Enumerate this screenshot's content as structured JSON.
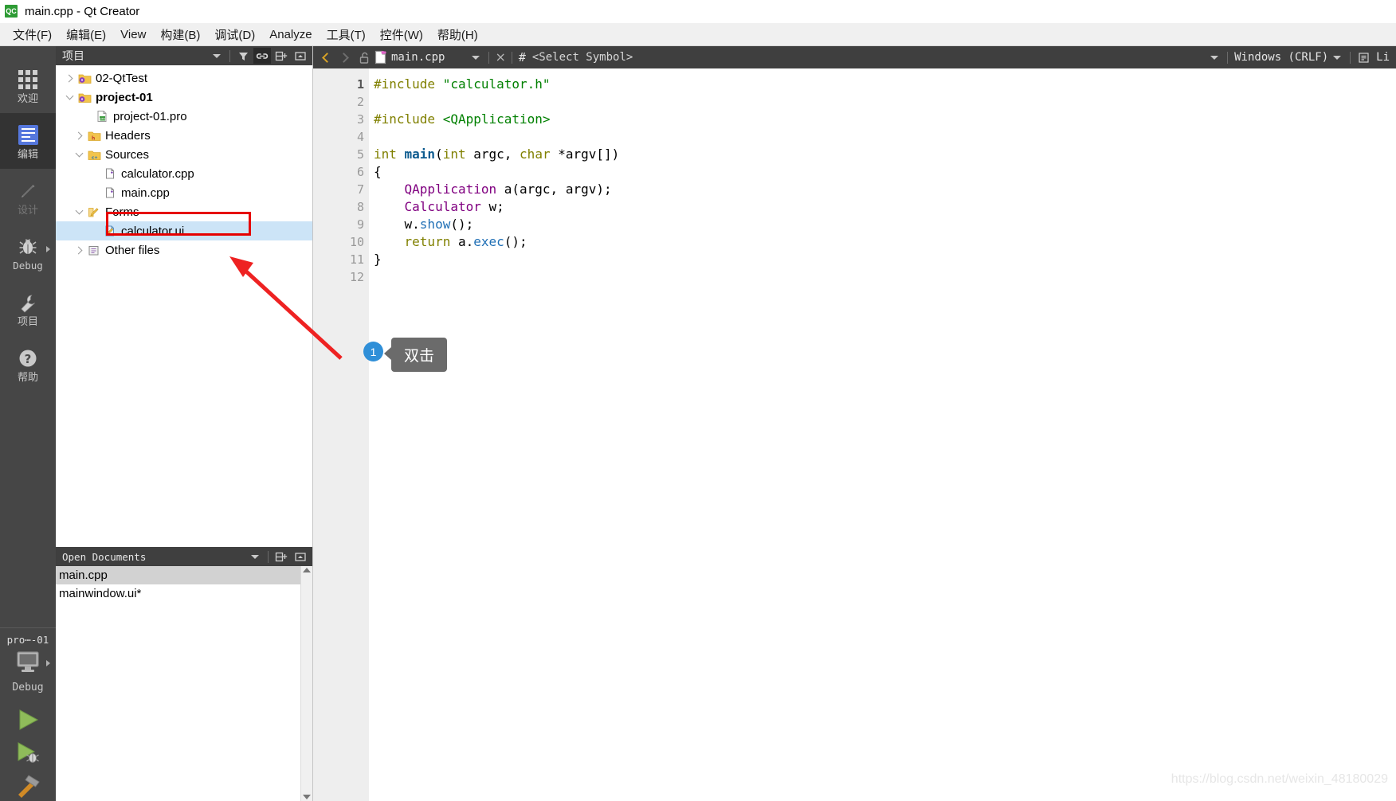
{
  "window": {
    "title": "main.cpp - Qt Creator",
    "logo_text": "QC",
    "logo_icon": "qt-creator-logo-icon"
  },
  "menubar": {
    "items": [
      {
        "label": "文件(F)",
        "name": "menu-file"
      },
      {
        "label": "编辑(E)",
        "name": "menu-edit"
      },
      {
        "label": "View",
        "name": "menu-view"
      },
      {
        "label": "构建(B)",
        "name": "menu-build"
      },
      {
        "label": "调试(D)",
        "name": "menu-debug"
      },
      {
        "label": "Analyze",
        "name": "menu-analyze"
      },
      {
        "label": "工具(T)",
        "name": "menu-tools"
      },
      {
        "label": "控件(W)",
        "name": "menu-widgets"
      },
      {
        "label": "帮助(H)",
        "name": "menu-help"
      }
    ]
  },
  "modebar": {
    "modes": [
      {
        "label": "欢迎",
        "icon": "grid-icon",
        "state": "normal"
      },
      {
        "label": "编辑",
        "icon": "edit-lines-icon",
        "state": "active"
      },
      {
        "label": "设计",
        "icon": "pencil-icon",
        "state": "disabled"
      },
      {
        "label": "Debug",
        "icon": "bug-icon",
        "state": "normal"
      },
      {
        "label": "项目",
        "icon": "wrench-icon",
        "state": "normal"
      },
      {
        "label": "帮助",
        "icon": "question-circle-icon",
        "state": "normal"
      }
    ],
    "kit": {
      "project_name": "pro⋯-01",
      "build_config": "Debug",
      "icon": "desktop-monitor-icon"
    },
    "run_buttons": [
      {
        "name": "run-button",
        "icon": "green-play-icon"
      },
      {
        "name": "debug-button",
        "icon": "play-with-bug-icon"
      },
      {
        "name": "build-button",
        "icon": "hammer-icon"
      }
    ]
  },
  "project_panel": {
    "title": "项目",
    "toolbar": [
      {
        "name": "filter-icon",
        "icon": "filter-icon",
        "active": false
      },
      {
        "name": "sync-with-editor-icon",
        "icon": "link-chain-icon",
        "active": true
      },
      {
        "name": "split-icon",
        "icon": "split-pane-icon",
        "active": false
      },
      {
        "name": "close-panel-icon",
        "icon": "minimize-panel-icon",
        "active": false
      }
    ],
    "tree": [
      {
        "label": "02-QtTest",
        "depth": 0,
        "twist": "collapsed",
        "icon": "project-folder-icon",
        "bold": false,
        "selected": false
      },
      {
        "label": "project-01",
        "depth": 0,
        "twist": "expanded",
        "icon": "project-folder-icon",
        "bold": true,
        "selected": false
      },
      {
        "label": "project-01.pro",
        "depth": 1,
        "twist": "none",
        "icon": "pro-file-icon",
        "bold": false,
        "selected": false
      },
      {
        "label": "Headers",
        "depth": 1,
        "twist": "collapsed",
        "icon": "headers-folder-icon",
        "bold": false,
        "selected": false
      },
      {
        "label": "Sources",
        "depth": 1,
        "twist": "expanded",
        "icon": "sources-folder-icon",
        "bold": false,
        "selected": false
      },
      {
        "label": "calculator.cpp",
        "depth": 2,
        "twist": "none",
        "icon": "cpp-file-icon",
        "bold": false,
        "selected": false
      },
      {
        "label": "main.cpp",
        "depth": 2,
        "twist": "none",
        "icon": "cpp-file-icon",
        "bold": false,
        "selected": false
      },
      {
        "label": "Forms",
        "depth": 1,
        "twist": "expanded",
        "icon": "forms-folder-icon",
        "bold": false,
        "selected": false
      },
      {
        "label": "calculator.ui",
        "depth": 2,
        "twist": "none",
        "icon": "ui-file-icon",
        "bold": false,
        "selected": true
      },
      {
        "label": "Other files",
        "depth": 1,
        "twist": "collapsed",
        "icon": "other-files-icon",
        "bold": false,
        "selected": false
      }
    ]
  },
  "open_documents": {
    "title": "Open Documents",
    "toolbar": [
      {
        "name": "split-icon",
        "icon": "split-pane-icon"
      },
      {
        "name": "close-panel-icon",
        "icon": "minimize-panel-icon"
      }
    ],
    "items": [
      {
        "label": "main.cpp",
        "selected": true
      },
      {
        "label": "mainwindow.ui*",
        "selected": false
      }
    ]
  },
  "editor_toolbar": {
    "back_icon": "chevron-left-icon",
    "forward_icon": "chevron-right-icon",
    "lock_icon": "unlocked-padlock-icon",
    "file_icon": "cpp-document-icon",
    "file_name": "main.cpp",
    "close_label": "×",
    "hash_label": "#",
    "symbol_placeholder": "<Select Symbol>",
    "line_ending": "Windows (CRLF)",
    "text_encoding_icon": "text-lines-icon",
    "encoding_label": "Li"
  },
  "code": {
    "lines": [
      {
        "number": "1",
        "fold": false,
        "tokens": [
          {
            "t": "#include ",
            "c": "pre"
          },
          {
            "t": "\"calculator.h\"",
            "c": "str"
          }
        ]
      },
      {
        "number": "2",
        "fold": false,
        "tokens": []
      },
      {
        "number": "3",
        "fold": false,
        "tokens": [
          {
            "t": "#include ",
            "c": "pre"
          },
          {
            "t": "<QApplication>",
            "c": "str"
          }
        ]
      },
      {
        "number": "4",
        "fold": false,
        "tokens": []
      },
      {
        "number": "5",
        "fold": true,
        "tokens": [
          {
            "t": "int ",
            "c": "kw"
          },
          {
            "t": "main",
            "c": "fn"
          },
          {
            "t": "(",
            "c": "punc"
          },
          {
            "t": "int",
            "c": "kw"
          },
          {
            "t": " argc, ",
            "c": "plain"
          },
          {
            "t": "char",
            "c": "kw"
          },
          {
            "t": " *argv[])",
            "c": "plain"
          }
        ]
      },
      {
        "number": "6",
        "fold": false,
        "tokens": [
          {
            "t": "{",
            "c": "punc"
          }
        ]
      },
      {
        "number": "7",
        "fold": false,
        "tokens": [
          {
            "t": "    ",
            "c": "plain"
          },
          {
            "t": "QApplication",
            "c": "type"
          },
          {
            "t": " a(argc, argv);",
            "c": "plain"
          }
        ]
      },
      {
        "number": "8",
        "fold": false,
        "tokens": [
          {
            "t": "    ",
            "c": "plain"
          },
          {
            "t": "Calculator",
            "c": "type"
          },
          {
            "t": " w;",
            "c": "plain"
          }
        ]
      },
      {
        "number": "9",
        "fold": false,
        "tokens": [
          {
            "t": "    w.",
            "c": "plain"
          },
          {
            "t": "show",
            "c": "mem"
          },
          {
            "t": "();",
            "c": "plain"
          }
        ]
      },
      {
        "number": "10",
        "fold": false,
        "tokens": [
          {
            "t": "    ",
            "c": "plain"
          },
          {
            "t": "return",
            "c": "kw"
          },
          {
            "t": " a.",
            "c": "plain"
          },
          {
            "t": "exec",
            "c": "mem"
          },
          {
            "t": "();",
            "c": "plain"
          }
        ]
      },
      {
        "number": "11",
        "fold": false,
        "tokens": [
          {
            "t": "}",
            "c": "punc"
          }
        ]
      },
      {
        "number": "12",
        "fold": false,
        "tokens": []
      }
    ]
  },
  "annotations": {
    "badge_number": "1",
    "tooltip_text": "双击",
    "highlight_color": "#e60000",
    "arrow_color": "#ee2222",
    "badge_color": "#2f8fd8"
  },
  "watermark": {
    "text": "https://blog.csdn.net/weixin_48180029"
  }
}
